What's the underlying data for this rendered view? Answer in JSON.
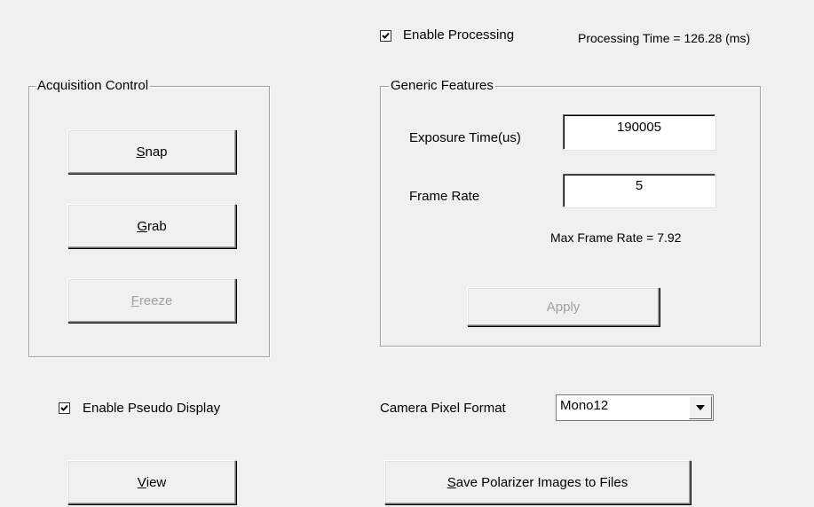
{
  "top": {
    "enable_processing_label": "Enable Processing",
    "enable_processing_checked": true,
    "processing_time_text": "Processing Time = 126.28 (ms)"
  },
  "acquisition": {
    "title": "Acquisition Control",
    "snap": {
      "mnemonic": "S",
      "rest": "nap",
      "enabled": true
    },
    "grab": {
      "mnemonic": "G",
      "rest": "rab",
      "enabled": true
    },
    "freeze": {
      "mnemonic": "F",
      "rest": "reeze",
      "enabled": false
    }
  },
  "generic": {
    "title": "Generic Features",
    "exposure_label": "Exposure Time(us)",
    "exposure_value": "190005",
    "frame_rate_label": "Frame Rate",
    "frame_rate_value": "5",
    "max_frame_rate_text": "Max Frame Rate = 7.92",
    "apply_label": "Apply",
    "apply_enabled": false
  },
  "pseudo": {
    "label": "Enable Pseudo Display",
    "checked": true
  },
  "pixel_format": {
    "label": "Camera Pixel Format",
    "selected": "Mono12"
  },
  "view_button": {
    "mnemonic": "V",
    "rest": "iew"
  },
  "save_button": {
    "mnemonic": "S",
    "rest": "ave Polarizer Images to Files"
  },
  "icons": {
    "checkmark": "checkmark-icon",
    "dropdown": "chevron-down-icon"
  }
}
